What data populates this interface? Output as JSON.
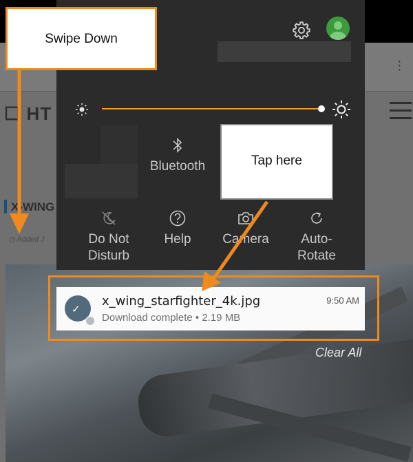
{
  "background_page": {
    "logo_text": "HT",
    "article_title": "X-WING S",
    "added_text": "Added J"
  },
  "shade": {
    "icons": {
      "settings": "gear-icon",
      "account": "avatar"
    },
    "brightness": {
      "level": 1.0,
      "accent": "#f0a020"
    },
    "tiles": [
      {
        "label": "Bluetooth",
        "icon": "bluetooth-icon"
      },
      {
        "label": "Do Not Disturb",
        "line1": "Do Not",
        "line2": "Disturb",
        "icon": "do-not-disturb-icon"
      },
      {
        "label": "Help",
        "icon": "help-icon"
      },
      {
        "label": "Camera",
        "icon": "camera-icon"
      },
      {
        "label": "Auto-Rotate",
        "line1": "Auto-",
        "line2": "Rotate",
        "icon": "auto-rotate-icon"
      }
    ]
  },
  "notification": {
    "filename": "x_wing_starfighter_4k.jpg",
    "time": "9:50 AM",
    "status": "Download complete • 2.19 MB"
  },
  "clear_all": "Clear All",
  "annotations": {
    "swipe_down": "Swipe Down",
    "tap_here": "Tap here",
    "accent_color": "#f08a1c"
  }
}
